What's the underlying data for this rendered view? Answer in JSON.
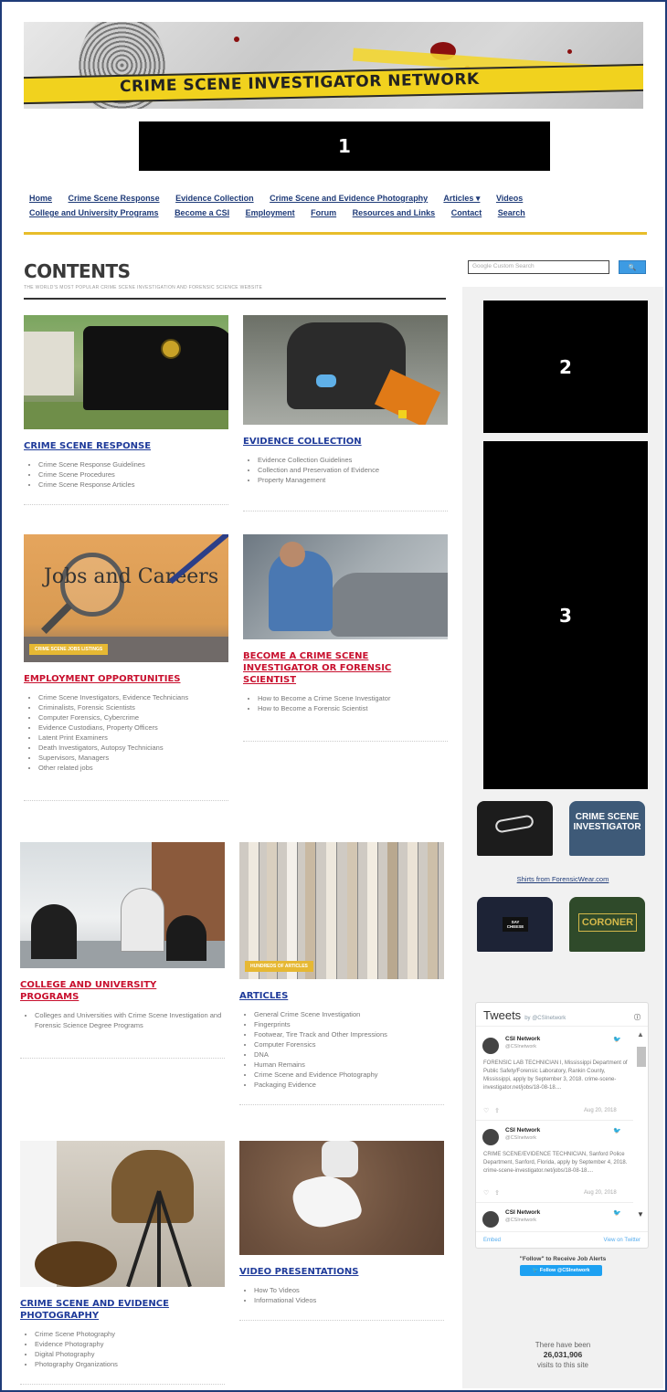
{
  "banner": {
    "title": "CRIME SCENE INVESTIGATOR NETWORK"
  },
  "redactions": [
    "1",
    "2",
    "3"
  ],
  "nav": {
    "items": [
      "Home",
      "Crime Scene Response",
      "Evidence Collection",
      "Crime Scene and Evidence Photography",
      "Articles ▾",
      "Videos",
      "College and University Programs",
      "Become a CSI",
      "Employment",
      "Forum",
      "Resources and Links",
      "Contact",
      "Search"
    ]
  },
  "contents": {
    "title": "CONTENTS",
    "subtitle": "THE WORLD'S MOST POPULAR CRIME SCENE INVESTIGATION AND FORENSIC SCIENCE WEBSITE"
  },
  "cards": [
    {
      "title": "CRIME SCENE RESPONSE",
      "color": "#1f3b9a",
      "badge": "",
      "items": [
        "Crime Scene Response Guidelines",
        "Crime Scene Procedures",
        "Crime Scene Response Articles"
      ]
    },
    {
      "title": "EVIDENCE COLLECTION",
      "color": "#1f3b9a",
      "badge": "",
      "items": [
        "Evidence Collection Guidelines",
        "Collection and Preservation of Evidence",
        "Property Management"
      ]
    },
    {
      "title": "EMPLOYMENT OPPORTUNITIES",
      "color": "#c8102e",
      "badge": "CRIME SCENE JOBS LISTINGS",
      "image_text": "Jobs and Careers",
      "items": [
        "Crime Scene Investigators, Evidence Technicians",
        "Criminalists, Forensic Scientists",
        "Computer Forensics, Cybercrime",
        "Evidence Custodians, Property Officers",
        "Latent Print Examiners",
        "Death Investigators, Autopsy Technicians",
        "Supervisors, Managers",
        "Other related jobs"
      ]
    },
    {
      "title": "BECOME A CRIME SCENE INVESTIGATOR OR FORENSIC SCIENTIST",
      "color": "#c8102e",
      "badge": "",
      "items": [
        "How to Become a Crime Scene Investigator",
        "How to Become a Forensic Scientist"
      ]
    },
    {
      "title": "COLLEGE AND UNIVERSITY PROGRAMS",
      "color": "#c8102e",
      "badge": "",
      "items": [
        "Colleges and Universities with Crime Scene Investigation and Forensic Science Degree Programs"
      ]
    },
    {
      "title": "ARTICLES",
      "color": "#1f3b9a",
      "badge": "HUNDREDS OF ARTICLES",
      "items": [
        "General Crime Scene Investigation",
        "Fingerprints",
        "Footwear, Tire Track and Other Impressions",
        "Computer Forensics",
        "DNA",
        "Human Remains",
        "Crime Scene and Evidence Photography",
        "Packaging Evidence"
      ]
    },
    {
      "title": "CRIME SCENE AND EVIDENCE PHOTOGRAPHY",
      "color": "#1f3b9a",
      "badge": "",
      "items": [
        "Crime Scene Photography",
        "Evidence Photography",
        "Digital Photography",
        "Photography Organizations"
      ]
    },
    {
      "title": "VIDEO PRESENTATIONS",
      "color": "#1f3b9a",
      "badge": "",
      "items": [
        "How To Videos",
        "Informational Videos"
      ]
    }
  ],
  "sidebar": {
    "search_placeholder": "Google Custom Search",
    "search_button": "🔍",
    "shirts": {
      "blue_text": "CRIME SCENE INVESTIGATOR",
      "navy_text": "SAY CHEESE",
      "green_text": "CORONER"
    },
    "shirts_link": "Shirts from ForensicWear.com",
    "twitter": {
      "heading": "Tweets",
      "by": "by @CSInetwork",
      "info": "ⓘ",
      "tweets": [
        {
          "name": "CSI Network",
          "handle": "@CSInetwork",
          "text": "FORENSIC LAB TECHNICIAN I, Mississippi Department of Public Safety/Forensic Laboratory, Rankin County, Mississippi, apply by September 3, 2018. crime-scene-investigator.net/jobs/18-08-18....",
          "date": "Aug 20, 2018"
        },
        {
          "name": "CSI Network",
          "handle": "@CSInetwork",
          "text": "CRIME SCENE/EVIDENCE TECHNICIAN, Sanford Police Department, Sanford, Florida, apply by September 4, 2018. crime-scene-investigator.net/jobs/18-08-18....",
          "date": "Aug 20, 2018"
        },
        {
          "name": "CSI Network",
          "handle": "@CSInetwork",
          "text": "",
          "date": ""
        }
      ],
      "embed": "Embed",
      "view": "View on Twitter"
    },
    "follow_caption": "\"Follow\" to Receive Job Alerts",
    "follow_button": "🐦 Follow @CSInetwork",
    "visits_pre": "There have been",
    "visits_count": "26,031,906",
    "visits_post": "visits to this site"
  }
}
